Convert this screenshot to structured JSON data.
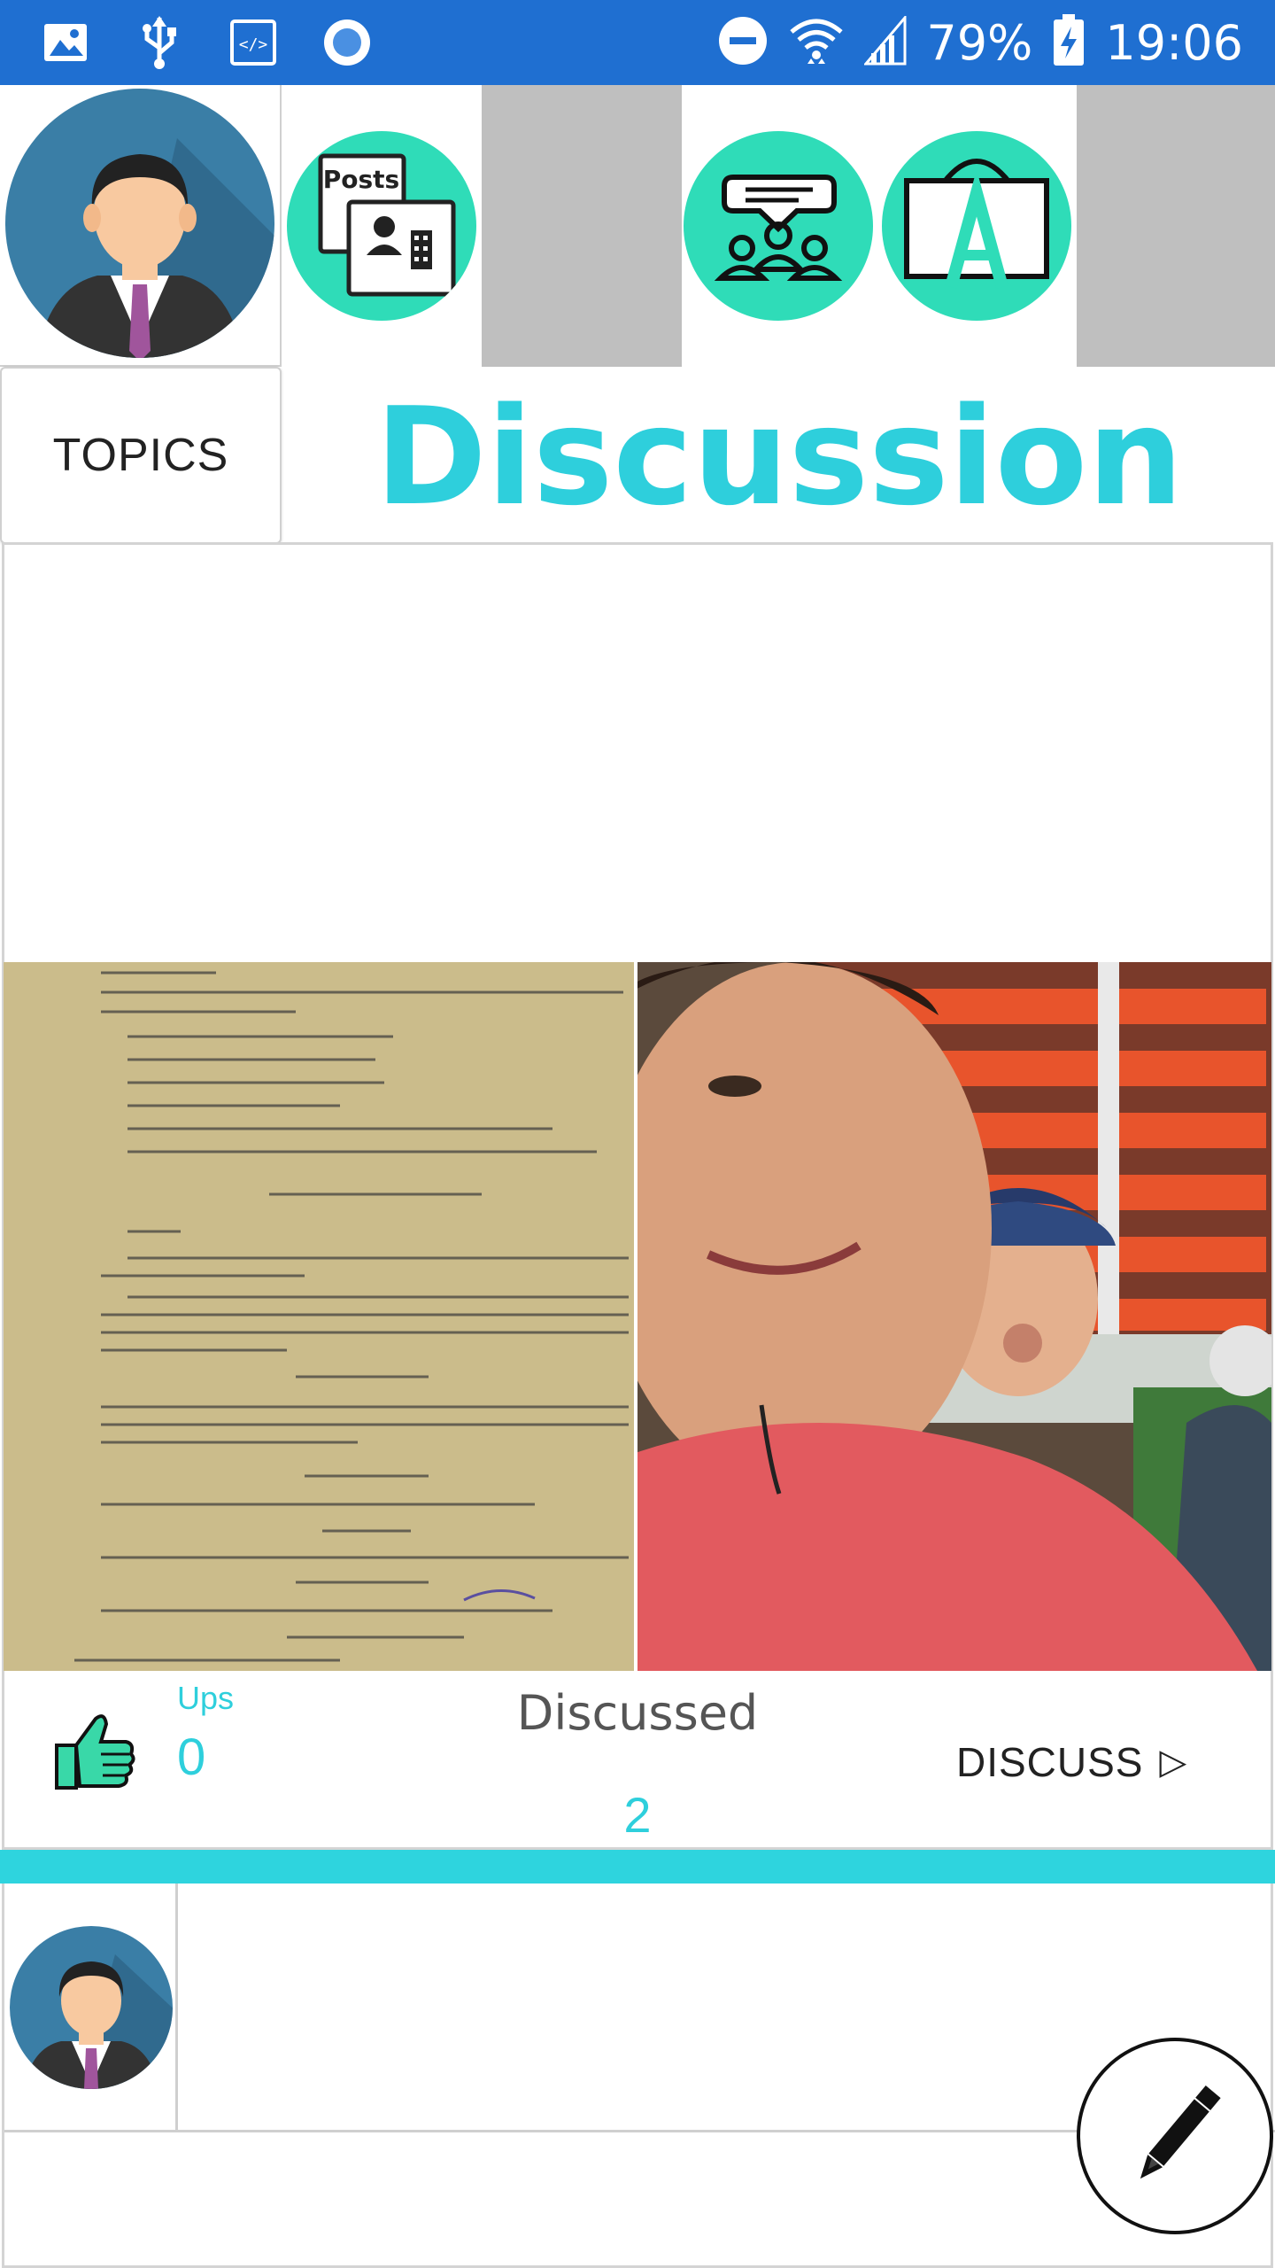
{
  "status_bar": {
    "battery": "79%",
    "time": "19:06",
    "left_icons": [
      "image-icon",
      "usb-icon",
      "code-icon",
      "record-icon"
    ],
    "right_icons": [
      "do-not-disturb-icon",
      "wifi-icon",
      "signal-icon",
      "battery-charging-icon"
    ]
  },
  "header": {
    "nav_icons": [
      "posts-icon",
      "group-chat-icon",
      "presentation-a-icon"
    ],
    "topics_label": "TOPICS",
    "title": "Discussion"
  },
  "post": {
    "text": "",
    "images": [
      "chemistry-textbook-page-photo",
      "selfie-photo"
    ],
    "ups_label": "Ups",
    "ups_count": "0",
    "discussed_label": "Discussed",
    "discussed_count": "2",
    "discuss_button": "DISCUSS",
    "discuss_arrow": "▷"
  },
  "comment": {
    "avatar": "user-avatar",
    "text": ""
  },
  "fab": {
    "icon": "pencil-icon"
  },
  "colors": {
    "status_bar": "#1f6fd1",
    "accent": "#2ecfdc",
    "icon_circle": "#2fdcb8",
    "divider": "#d4d4d4"
  }
}
